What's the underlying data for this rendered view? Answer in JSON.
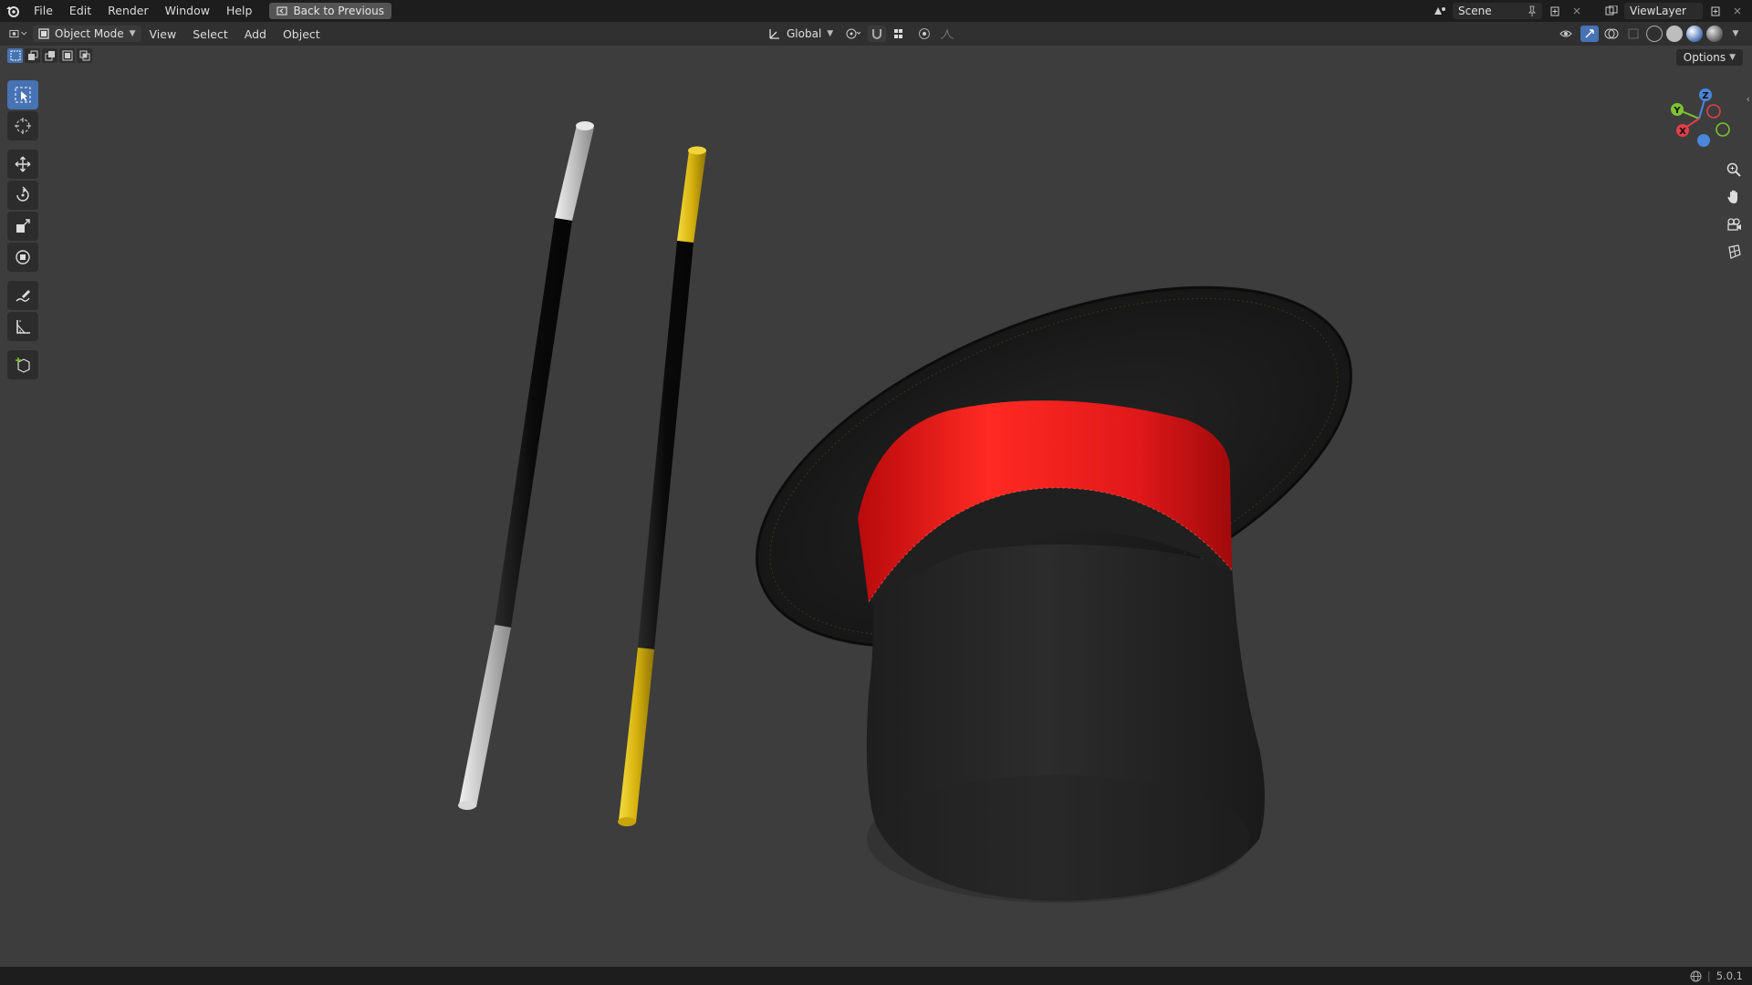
{
  "topbar": {
    "menu": [
      "File",
      "Edit",
      "Render",
      "Window",
      "Help"
    ],
    "back_label": "Back to Previous",
    "scene_label": "Scene",
    "viewlayer_label": "ViewLayer"
  },
  "header": {
    "mode_label": "Object Mode",
    "menus": [
      "View",
      "Select",
      "Add",
      "Object"
    ],
    "transform_orientation": "Global"
  },
  "viewport": {
    "options_label": "Options",
    "gizmo_labels": {
      "z": "Z",
      "y": "Y",
      "x": "X"
    }
  },
  "status": {
    "version": "5.0.1"
  },
  "colors": {
    "accent": "#4772b3",
    "hat_band": "#e0181a",
    "wand_gold": "#d8b610",
    "wand_silver": "#c8c8c8"
  },
  "icons": {
    "toolbar": [
      "select-box-icon",
      "cursor-icon",
      "move-icon",
      "rotate-icon",
      "scale-icon",
      "transform-icon",
      "annotate-icon",
      "measure-icon",
      "add-cube-icon"
    ],
    "nav": [
      "zoom-icon",
      "pan-hand-icon",
      "camera-icon",
      "grid-ortho-icon"
    ]
  }
}
